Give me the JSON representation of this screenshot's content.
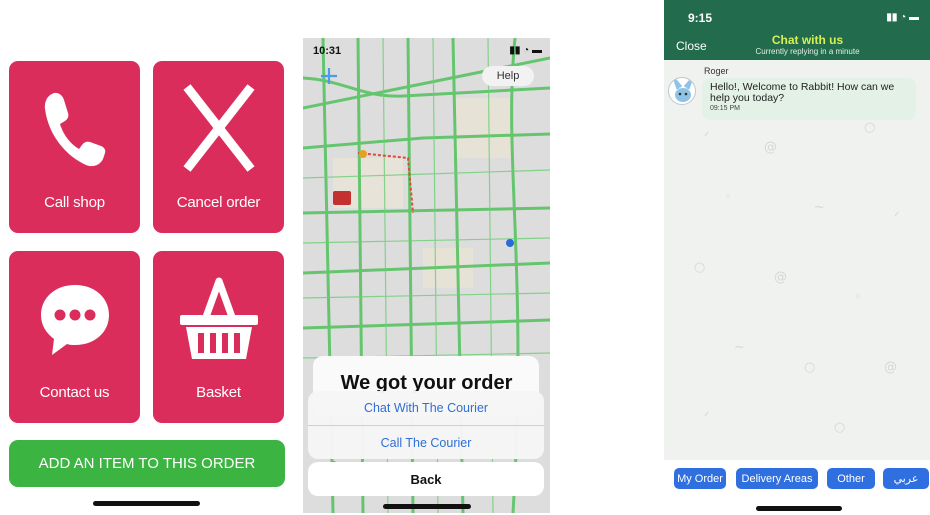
{
  "panel1": {
    "tiles": {
      "call": "Call shop",
      "cancel": "Cancel order",
      "contact": "Contact us",
      "basket": "Basket"
    },
    "add_item": "ADD AN ITEM TO THIS ORDER"
  },
  "panel2": {
    "status_time": "10:31",
    "help": "Help",
    "sheet_title": "We got your order",
    "actions": [
      "Chat With The Courier",
      "Call The Courier"
    ],
    "back": "Back"
  },
  "panel3": {
    "status_time": "9:15",
    "close": "Close",
    "title": "Chat with us",
    "subtitle": "Currently replying in a minute",
    "sender": "Roger",
    "message": "Hello!, Welcome to Rabbit! How can we help you today?",
    "message_time": "09:15 PM",
    "chips": [
      "My Order",
      "Delivery Areas",
      "Other",
      "عربي"
    ]
  },
  "colors": {
    "tile": "#db2d5b",
    "add_button": "#3bb441",
    "chat_header": "#236b4d",
    "chip": "#2f6fe0"
  }
}
